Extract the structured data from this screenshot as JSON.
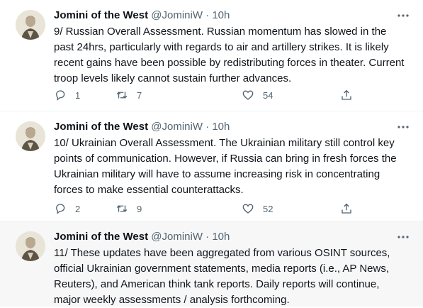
{
  "tweets": [
    {
      "name": "Jomini of the West",
      "handle": "@JominiW",
      "dot": "·",
      "time": "10h",
      "text": "9/ Russian Overall Assessment. Russian momentum has slowed in the past 24hrs, particularly with regards to air and artillery strikes. It is likely recent gains have been possible by redistributing forces in theater. Current troop levels likely cannot sustain further advances.",
      "replies": "1",
      "retweets": "7",
      "likes": "54"
    },
    {
      "name": "Jomini of the West",
      "handle": "@JominiW",
      "dot": "·",
      "time": "10h",
      "text": "10/ Ukrainian Overall Assessment. The Ukrainian military still control key points of communication. However, if Russia can bring in fresh forces the Ukrainian military will have to assume increasing risk in concentrating forces to make essential counterattacks.",
      "replies": "2",
      "retweets": "9",
      "likes": "52"
    },
    {
      "name": "Jomini of the West",
      "handle": "@JominiW",
      "dot": "·",
      "time": "10h",
      "text": "11/ These updates have been aggregated from various OSINT sources, official Ukrainian government statements, media reports (i.e., AP News, Reuters), and American think tank reports. Daily reports will continue, major weekly assessments / analysis forthcoming."
    }
  ],
  "icons": {
    "reply": "reply-icon",
    "retweet": "retweet-icon",
    "like": "heart-icon",
    "share": "share-icon",
    "more": "more-icon"
  },
  "colors": {
    "text": "#0f1419",
    "secondary": "#536471",
    "divider": "#eff3f4",
    "highlight_bg": "#f7f7f7"
  }
}
